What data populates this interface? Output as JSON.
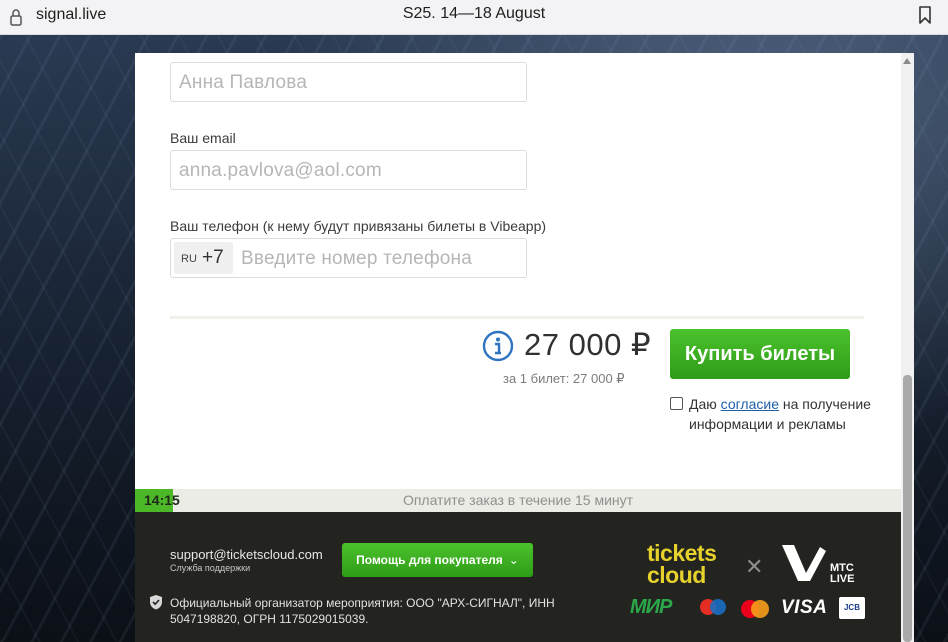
{
  "browser": {
    "domain": "signal.live",
    "title": "S25. 14—18 August",
    "icons": [
      "lock-icon",
      "bookmark-icon"
    ]
  },
  "form": {
    "name_field": {
      "placeholder": "Анна Павлова"
    },
    "email_label": "Ваш email",
    "email_field": {
      "placeholder": "anna.pavlova@aol.com"
    },
    "phone_label": "Ваш телефон (к нему будут привязаны билеты в Vibeapp)",
    "phone_field": {
      "country": "RU",
      "code": "+7",
      "placeholder": "Введите номер телефона"
    }
  },
  "order": {
    "total": "27 000 ₽",
    "per_ticket": "за 1 билет: 27 000 ₽",
    "buy_label": "Купить билеты",
    "consent_prefix": "Даю ",
    "consent_link": "согласие",
    "consent_suffix": " на получение информации и рекламы",
    "consent_checked": false,
    "info_color": "#2f74c0",
    "accent_green": "#3aae20"
  },
  "timer": {
    "time": "14:15",
    "message": "Оплатите заказ в течение 15 минут",
    "remaining_fraction": 0.05
  },
  "footer": {
    "support_email": "support@ticketscloud.com",
    "support_label": "Служба поддержки",
    "help_label": "Помощь для покупателя",
    "organizer": "Официальный организатор мероприятия: ООО \"АРХ-СИГНАЛ\", ИНН 5047198820, ОГРН 1175029015039.",
    "logo_tickets_cloud": "tickets cloud",
    "logo_mts": "МТС LIVE",
    "payments": {
      "mir": "МИР",
      "visa": "VISA",
      "jcb": "JCB"
    },
    "logo_color": "#e6d12d"
  }
}
